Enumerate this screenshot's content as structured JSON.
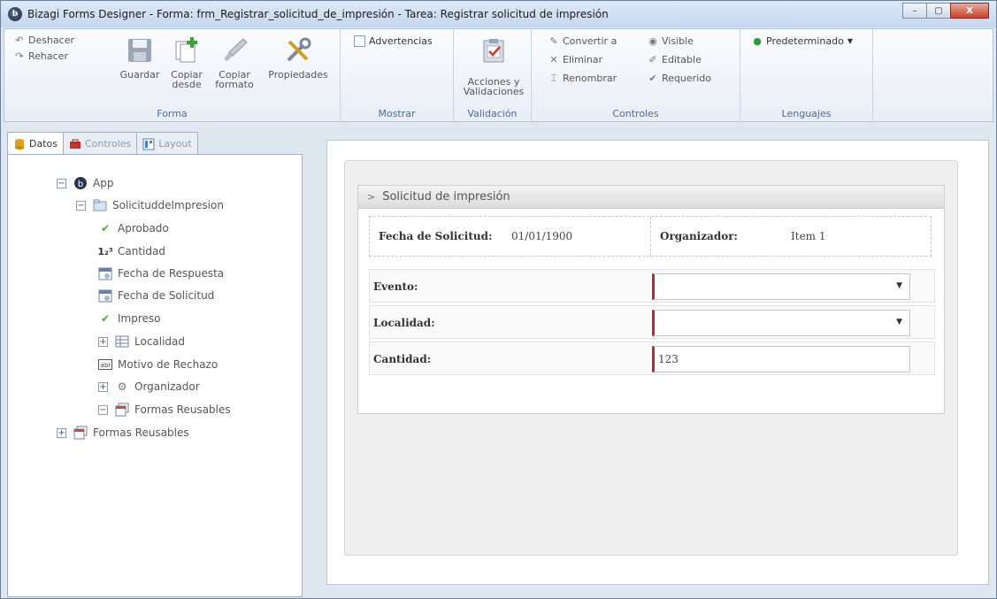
{
  "window": {
    "title": "Bizagi Forms Designer  - Forma: frm_Registrar_solicitud_de_impresión - Tarea:  Registrar solicitud de impresión",
    "min": "–",
    "max": "▢",
    "close": "X"
  },
  "ribbon": {
    "forma": {
      "label": "Forma",
      "undo": "Deshacer",
      "redo": "Rehacer",
      "save": "Guardar",
      "copy_from_1": "Copiar",
      "copy_from_2": "desde",
      "copy_format_1": "Copiar",
      "copy_format_2": "formato",
      "properties": "Propiedades"
    },
    "mostrar": {
      "label": "Mostrar",
      "warnings": "Advertencias"
    },
    "validacion": {
      "label": "Validación",
      "actions_1": "Acciones y",
      "actions_2": "Validaciones"
    },
    "controles": {
      "label": "Controles",
      "convert": "Convertir a",
      "delete": "Eliminar",
      "rename": "Renombrar",
      "visible": "Visible",
      "editable": "Editable",
      "required": "Requerido"
    },
    "lenguajes": {
      "label": "Lenguajes",
      "default": "Predeterminado"
    }
  },
  "left_panel": {
    "tabs": [
      "Datos",
      "Controles",
      "Layout"
    ],
    "tree": {
      "app": "App",
      "entity": "SolicituddeImpresion",
      "aprobado": "Aprobado",
      "cantidad": "Cantidad",
      "fecha_respuesta": "Fecha de Respuesta",
      "fecha_solicitud": "Fecha de Solicitud",
      "impreso": "Impreso",
      "localidad": "Localidad",
      "motivo": "Motivo de Rechazo",
      "organizador": "Organizador",
      "formas_inner": "Formas Reusables",
      "formas_outer": "Formas Reusables"
    }
  },
  "form": {
    "group_title": "Solicitud de impresión",
    "fecha_label": "Fecha de Solicitud:",
    "fecha_value": "01/01/1900",
    "organizador_label": "Organizador:",
    "organizador_value": "Item 1",
    "evento_label": "Evento:",
    "localidad_label": "Localidad:",
    "cantidad_label": "Cantidad:",
    "cantidad_value": "123"
  }
}
